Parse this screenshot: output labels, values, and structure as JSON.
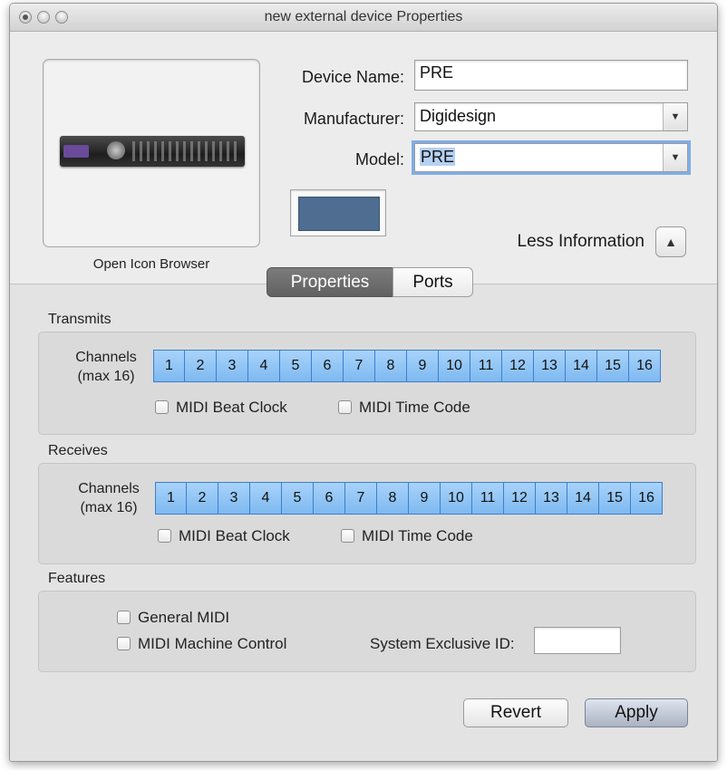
{
  "window": {
    "title": "new external device Properties"
  },
  "icon": {
    "open_label": "Open Icon Browser"
  },
  "fields": {
    "device_name": {
      "label": "Device Name:",
      "value": "PRE"
    },
    "manufacturer": {
      "label": "Manufacturer:",
      "value": "Digidesign"
    },
    "model": {
      "label": "Model:",
      "value": "PRE"
    }
  },
  "color_swatch": "#4e6d91",
  "less_info": {
    "label": "Less Information"
  },
  "tabs": [
    {
      "label": "Properties"
    },
    {
      "label": "Ports"
    }
  ],
  "transmits": {
    "title": "Transmits",
    "channels_label_1": "Channels",
    "channels_label_2": "(max 16)",
    "channels": [
      "1",
      "2",
      "3",
      "4",
      "5",
      "6",
      "7",
      "8",
      "9",
      "10",
      "11",
      "12",
      "13",
      "14",
      "15",
      "16"
    ],
    "beat_clock": "MIDI Beat Clock",
    "time_code": "MIDI Time Code"
  },
  "receives": {
    "title": "Receives",
    "channels_label_1": "Channels",
    "channels_label_2": "(max 16)",
    "channels": [
      "1",
      "2",
      "3",
      "4",
      "5",
      "6",
      "7",
      "8",
      "9",
      "10",
      "11",
      "12",
      "13",
      "14",
      "15",
      "16"
    ],
    "beat_clock": "MIDI Beat Clock",
    "time_code": "MIDI Time Code"
  },
  "features": {
    "title": "Features",
    "general_midi": "General MIDI",
    "machine_control": "MIDI Machine Control",
    "sysex_label": "System Exclusive ID:",
    "sysex_value": ""
  },
  "buttons": {
    "revert": "Revert",
    "apply": "Apply"
  }
}
